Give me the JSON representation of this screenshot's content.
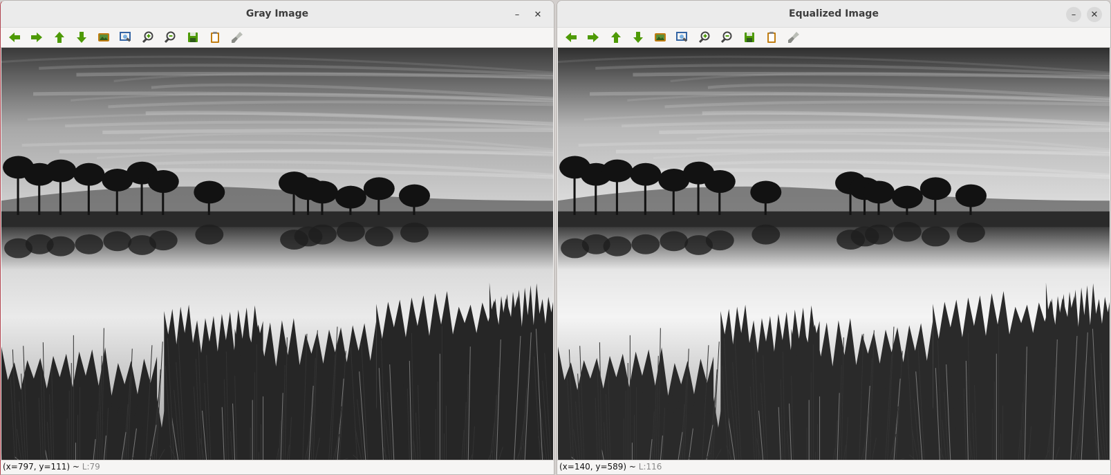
{
  "windows": [
    {
      "title": "Gray Image",
      "minimize_glyph": "–",
      "close_glyph": "✕",
      "status_coords": "(x=797, y=111) ~ ",
      "status_luminance": "L:79",
      "style": "original"
    },
    {
      "title": "Equalized Image",
      "minimize_glyph": "–",
      "close_glyph": "✕",
      "status_coords": "(x=140, y=589) ~ ",
      "status_luminance": "L:116",
      "style": "equalized"
    }
  ],
  "toolbar_icons": [
    {
      "name": "pan-left-icon",
      "color": "#4e9a06"
    },
    {
      "name": "pan-right-icon",
      "color": "#4e9a06"
    },
    {
      "name": "pan-up-icon",
      "color": "#4e9a06"
    },
    {
      "name": "pan-down-icon",
      "color": "#4e9a06"
    },
    {
      "name": "zoom-fit-icon",
      "color": "#c17d11"
    },
    {
      "name": "zoom-selection-icon",
      "color": "#3465a4"
    },
    {
      "name": "zoom-in-icon",
      "color": "#4e9a06"
    },
    {
      "name": "zoom-out-icon",
      "color": "#4e9a06"
    },
    {
      "name": "save-image-icon",
      "color": "#4e9a06"
    },
    {
      "name": "properties-icon",
      "color": "#c17d11"
    },
    {
      "name": "brush-icon",
      "color": "#888a85"
    }
  ]
}
